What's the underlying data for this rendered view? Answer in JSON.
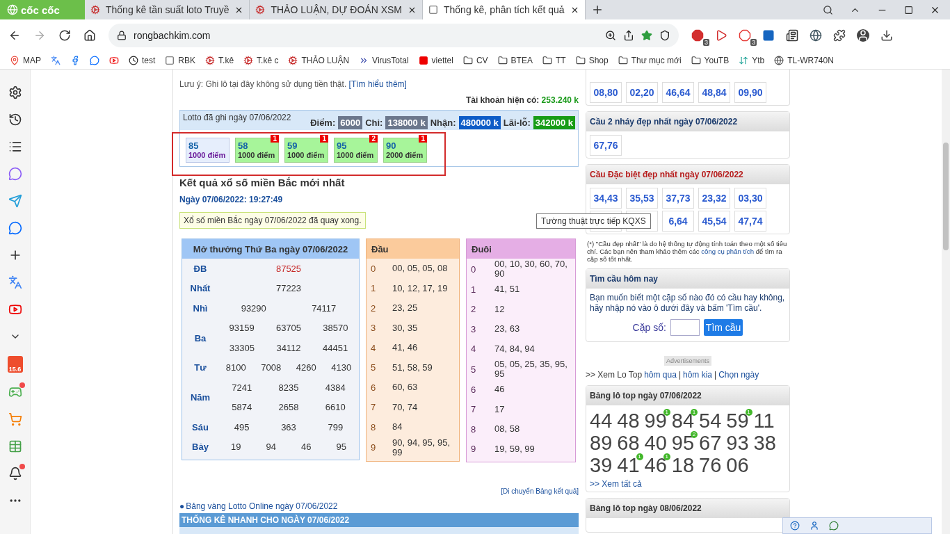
{
  "browser": {
    "logo": "cốc cốc",
    "tabs": [
      {
        "title": "Thống kê tần suất loto Truyề",
        "kind": "logo",
        "selected": false
      },
      {
        "title": "THẢO LUẬN, DỰ ĐOÁN XSM",
        "kind": "logo",
        "selected": false
      },
      {
        "title": "Thống kê, phân tích kết quả",
        "kind": "rbk",
        "selected": true
      }
    ],
    "url": "rongbachkim.com",
    "extensions": [
      {
        "kind": "abp",
        "badge": "3"
      },
      {
        "kind": "play"
      },
      {
        "kind": "stop",
        "badge": "3"
      },
      {
        "kind": "j"
      },
      {
        "kind": "news"
      },
      {
        "kind": "e"
      },
      {
        "kind": "puzzle"
      },
      {
        "kind": "avatar"
      },
      {
        "kind": "download"
      }
    ],
    "bookmarks": [
      {
        "kind": "pin",
        "label": "MAP"
      },
      {
        "kind": "translate"
      },
      {
        "kind": "facebook"
      },
      {
        "kind": "zalo"
      },
      {
        "kind": "youtube"
      },
      {
        "kind": "clock",
        "label": "test"
      },
      {
        "kind": "rbk",
        "label": "RBK"
      },
      {
        "kind": "logo",
        "label": "T.kê"
      },
      {
        "kind": "logo",
        "label": "T.kê c"
      },
      {
        "kind": "logo",
        "label": "THẢO LUẬN"
      },
      {
        "kind": "virustotal",
        "label": "VirusTotal"
      },
      {
        "kind": "viettel",
        "label": "viettel"
      },
      {
        "kind": "folder",
        "label": "CV"
      },
      {
        "kind": "folder",
        "label": "BTEA"
      },
      {
        "kind": "folder",
        "label": "TT"
      },
      {
        "kind": "folder",
        "label": "Shop"
      },
      {
        "kind": "folder",
        "label": "Thư mục mới"
      },
      {
        "kind": "folder",
        "label": "YouTB"
      },
      {
        "kind": "wheel",
        "label": "Ytb"
      },
      {
        "kind": "globe",
        "label": "TL-WR740N"
      }
    ]
  },
  "sidebar": [
    {
      "kind": "settings"
    },
    {
      "kind": "history"
    },
    {
      "kind": "list"
    },
    {
      "kind": "messenger"
    },
    {
      "kind": "telegram"
    },
    {
      "kind": "zalo"
    },
    {
      "kind": "plus"
    },
    {
      "kind": "translate"
    },
    {
      "kind": "youtube"
    },
    {
      "kind": "collapse"
    },
    {
      "kind": "shop",
      "label": "15.6"
    },
    {
      "kind": "game"
    },
    {
      "kind": "cart"
    },
    {
      "kind": "sheet"
    },
    {
      "kind": "bell"
    },
    {
      "kind": "more"
    }
  ],
  "notice": {
    "text": "Lưu ý: Ghi lô tại đây không sử dụng tiền thật.",
    "link": "[Tìm hiểu thêm]"
  },
  "account": {
    "label": "Tài khoản hiện có:",
    "value": "253.240 k"
  },
  "lotto": {
    "title": "Lotto đã ghi ngày 07/06/2022",
    "summary": [
      {
        "label": "Điểm:",
        "value": "6000",
        "color": "#6b778c"
      },
      {
        "label": "Chi:",
        "value": "138000 k",
        "color": "#6b778c"
      },
      {
        "label": "Nhận:",
        "value": "480000 k",
        "color": "#0d5cc7"
      },
      {
        "label": "Lãi-lỗ:",
        "value": "342000 k",
        "color": "#169c16"
      }
    ],
    "picks": [
      {
        "number": "85",
        "points": "1000 điểm",
        "won": false
      },
      {
        "number": "58",
        "points": "1000 điểm",
        "won": true,
        "hits": "1"
      },
      {
        "number": "59",
        "points": "1000 điểm",
        "won": true,
        "hits": "1"
      },
      {
        "number": "95",
        "points": "1000 điểm",
        "won": true,
        "hits": "2"
      },
      {
        "number": "90",
        "points": "2000 điểm",
        "won": true,
        "hits": "1"
      }
    ]
  },
  "results_heading": "Kết quả xổ số miền Bắc mới nhất",
  "results_time": "Ngày 07/06/2022: 19:27:49",
  "results_status": "Xổ số miền Bắc ngày 07/06/2022 đã quay xong.",
  "tooltip": "Tường thuật trực tiếp KQXS",
  "prize_table": {
    "title": "Mở thưởng Thứ Ba ngày 07/06/2022",
    "rows": [
      {
        "prize": "ĐB",
        "kind": "special",
        "lines": [
          [
            "87525"
          ]
        ]
      },
      {
        "prize": "Nhất",
        "kind": "normal",
        "lines": [
          [
            "77223"
          ]
        ]
      },
      {
        "prize": "Nhì",
        "kind": "normal",
        "lines": [
          [
            "93290",
            "74117"
          ]
        ]
      },
      {
        "prize": "Ba",
        "kind": "normal",
        "lines": [
          [
            "93159",
            "63705",
            "38570"
          ],
          [
            "33305",
            "34112",
            "44451"
          ]
        ]
      },
      {
        "prize": "Tư",
        "kind": "normal",
        "lines": [
          [
            "8100",
            "7008",
            "4260",
            "4130"
          ]
        ]
      },
      {
        "prize": "Năm",
        "kind": "normal",
        "lines": [
          [
            "7241",
            "8235",
            "4384"
          ],
          [
            "5874",
            "2658",
            "6610"
          ]
        ]
      },
      {
        "prize": "Sáu",
        "kind": "normal",
        "lines": [
          [
            "495",
            "363",
            "799"
          ]
        ]
      },
      {
        "prize": "Bảy",
        "kind": "normal",
        "lines": [
          [
            "19",
            "94",
            "46",
            "95"
          ]
        ]
      }
    ]
  },
  "head_table": {
    "title": "Đầu",
    "rows": [
      {
        "digit": "0",
        "values": "00, 05, 05, 08"
      },
      {
        "digit": "1",
        "values": "10, 12, 17, 19"
      },
      {
        "digit": "2",
        "values": "23, 25"
      },
      {
        "digit": "3",
        "values": "30, 35"
      },
      {
        "digit": "4",
        "values": "41, 46"
      },
      {
        "digit": "5",
        "values": "51, 58, 59"
      },
      {
        "digit": "6",
        "values": "60, 63"
      },
      {
        "digit": "7",
        "values": "70, 74"
      },
      {
        "digit": "8",
        "values": "84"
      },
      {
        "digit": "9",
        "values": "90, 94, 95, 95, 99"
      }
    ]
  },
  "tail_table": {
    "title": "Đuôi",
    "rows": [
      {
        "digit": "0",
        "values": "00, 10, 30, 60, 70, 90"
      },
      {
        "digit": "1",
        "values": "41, 51"
      },
      {
        "digit": "2",
        "values": "12"
      },
      {
        "digit": "3",
        "values": "23, 63"
      },
      {
        "digit": "4",
        "values": "74, 84, 94"
      },
      {
        "digit": "5",
        "values": "05, 05, 25, 35, 95, 95"
      },
      {
        "digit": "6",
        "values": "46"
      },
      {
        "digit": "7",
        "values": "17"
      },
      {
        "digit": "8",
        "values": "08, 58"
      },
      {
        "digit": "9",
        "values": "19, 59, 99"
      }
    ]
  },
  "move_link": "[Di chuyển Bảng kết quả]",
  "gold_bullet": "●",
  "gold_link": "Bảng vàng Lotto Online ngày 07/06/2022",
  "quick_stats_title": "THỐNG KÊ NHANH CHO NGÀY 07/06/2022",
  "pair_boxes": [
    {
      "kind": "plain",
      "rows": [
        [
          "08,80",
          "02,20",
          "46,64",
          "48,84",
          "09,90"
        ]
      ]
    },
    {
      "kind": "normal",
      "title": "Cầu 2 nháy đẹp nhất ngày 07/06/2022",
      "rows": [
        [
          "67,76"
        ]
      ]
    },
    {
      "kind": "special",
      "title": "Cầu Đặc biệt đẹp nhất ngày 07/06/2022",
      "rows": [
        [
          "34,43",
          "35,53",
          "37,73",
          "23,32",
          "03,30"
        ],
        [
          "",
          "",
          "6,64",
          "45,54",
          "47,74"
        ]
      ]
    }
  ],
  "footnote": {
    "text": "(*) \"Cầu đẹp nhất\" là do hệ thống tự động tính toán theo một số tiêu chí. Các bạn nên tham khảo thêm các",
    "link": "công cụ phân tích",
    "after": "để tìm ra cặp số tốt nhất."
  },
  "search_box": {
    "title": "Tìm cầu hôm nay",
    "text": "Bạn muốn biết một cặp số nào đó có cầu hay không, hãy nhập nó vào ô dưới đây và bấm 'Tìm cầu'.",
    "label": "Cặp số:",
    "button": "Tìm cầu"
  },
  "ad_label": "Advertisements",
  "lo_top_nav": {
    "prefix": ">> Xem Lo Top",
    "links": [
      "hôm qua",
      "hôm kia",
      "Chọn ngày"
    ],
    "separator": "|"
  },
  "lo_top": [
    {
      "title": "Bảng lô top ngày 07/06/2022",
      "numbers": [
        {
          "n": "44"
        },
        {
          "n": "48"
        },
        {
          "n": "99",
          "hits": "1"
        },
        {
          "n": "84",
          "hits": "1"
        },
        {
          "n": "54"
        },
        {
          "n": "59",
          "hits": "1"
        },
        {
          "n": "11"
        },
        {
          "n": "89"
        },
        {
          "n": "68"
        },
        {
          "n": "40"
        },
        {
          "n": "95",
          "hits": "2"
        },
        {
          "n": "67"
        },
        {
          "n": "93"
        },
        {
          "n": "38"
        },
        {
          "n": "39"
        },
        {
          "n": "41",
          "hits": "1"
        },
        {
          "n": "46",
          "hits": "1"
        },
        {
          "n": "18"
        },
        {
          "n": "76"
        },
        {
          "n": "06"
        }
      ],
      "more": ">> Xem tất cả"
    },
    {
      "title": "Bảng lô top ngày 08/06/2022"
    }
  ]
}
